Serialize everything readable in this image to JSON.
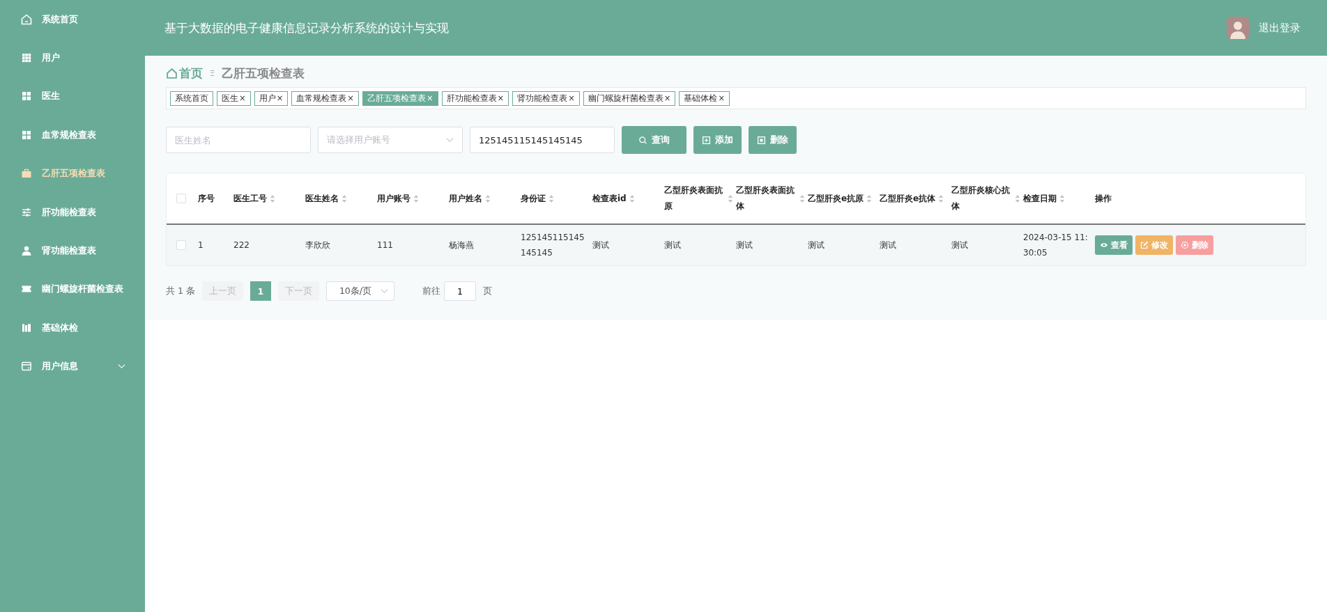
{
  "sidebar": {
    "items": [
      {
        "label": "系统首页",
        "selected": false
      },
      {
        "label": "用户",
        "selected": false
      },
      {
        "label": "医生",
        "selected": false
      },
      {
        "label": "血常规检查表",
        "selected": false
      },
      {
        "label": "乙肝五项检查表",
        "selected": true
      },
      {
        "label": "肝功能检查表",
        "selected": false
      },
      {
        "label": "肾功能检查表",
        "selected": false
      },
      {
        "label": "幽门螺旋杆菌检查表",
        "selected": false
      },
      {
        "label": "基础体检",
        "selected": false
      },
      {
        "label": "用户信息",
        "selected": false,
        "expanded": false
      }
    ]
  },
  "header": {
    "title": "基于大数据的电子健康信息记录分析系统的设计与实现",
    "logout": "退出登录"
  },
  "breadcrumb": {
    "home": "首页",
    "separator": "Ξ",
    "current": "乙肝五项检查表"
  },
  "tags": [
    {
      "label": "系统首页",
      "closable": false,
      "selected": false
    },
    {
      "label": "医生",
      "closable": true,
      "selected": false
    },
    {
      "label": "用户",
      "closable": true,
      "selected": false
    },
    {
      "label": "血常规检查表",
      "closable": true,
      "selected": false
    },
    {
      "label": "乙肝五项检查表",
      "closable": true,
      "selected": true
    },
    {
      "label": "肝功能检查表",
      "closable": true,
      "selected": false
    },
    {
      "label": "肾功能检查表",
      "closable": true,
      "selected": false
    },
    {
      "label": "幽门螺旋杆菌检查表",
      "closable": true,
      "selected": false
    },
    {
      "label": "基础体检",
      "closable": true,
      "selected": false
    }
  ],
  "tag_close": "×",
  "search": {
    "doctor_name": {
      "placeholder": "医生姓名"
    },
    "user_account": {
      "placeholder": "请选择用户账号"
    },
    "id_card": {
      "value": "125145115145145145"
    },
    "buttons": [
      {
        "kind": "search",
        "label": "查询"
      },
      {
        "kind": "add",
        "label": "添加"
      },
      {
        "kind": "delete",
        "label": "删除"
      }
    ]
  },
  "table": {
    "all_checked": false,
    "columns": [
      {
        "label": "序号",
        "sortable": false
      },
      {
        "label": "医生工号",
        "sortable": true
      },
      {
        "label": "医生姓名",
        "sortable": true
      },
      {
        "label": "用户账号",
        "sortable": true
      },
      {
        "label": "用户姓名",
        "sortable": true
      },
      {
        "label": "身份证",
        "sortable": true
      },
      {
        "label": "检查表id",
        "sortable": true
      },
      {
        "label": "乙型肝炎表面抗原",
        "sortable": true
      },
      {
        "label": "乙型肝炎表面抗体",
        "sortable": true
      },
      {
        "label": "乙型肝炎e抗原",
        "sortable": true
      },
      {
        "label": "乙型肝炎e抗体",
        "sortable": true
      },
      {
        "label": "乙型肝炎核心抗体",
        "sortable": true
      },
      {
        "label": "检查日期",
        "sortable": true
      },
      {
        "label": "操作",
        "sortable": false
      }
    ],
    "rows": [
      {
        "checked": false,
        "cells": [
          "1",
          "222",
          "李欣欣",
          "111",
          "杨海燕",
          "125145115145145145",
          "测试",
          "测试",
          "测试",
          "测试",
          "测试",
          "测试",
          "2024-03-15 11:30:05"
        ],
        "actions": [
          {
            "kind": "view",
            "label": "查看"
          },
          {
            "kind": "edit",
            "label": "修改"
          },
          {
            "kind": "delete",
            "label": "删除"
          }
        ]
      }
    ]
  },
  "pagination": {
    "total": "共 1 条",
    "prev": "上一页",
    "pages": [
      {
        "label": "1",
        "selected": true
      }
    ],
    "next": "下一页",
    "page_size": "10条/页",
    "goto": "前往",
    "goto_value": "1",
    "page_unit": "页"
  }
}
